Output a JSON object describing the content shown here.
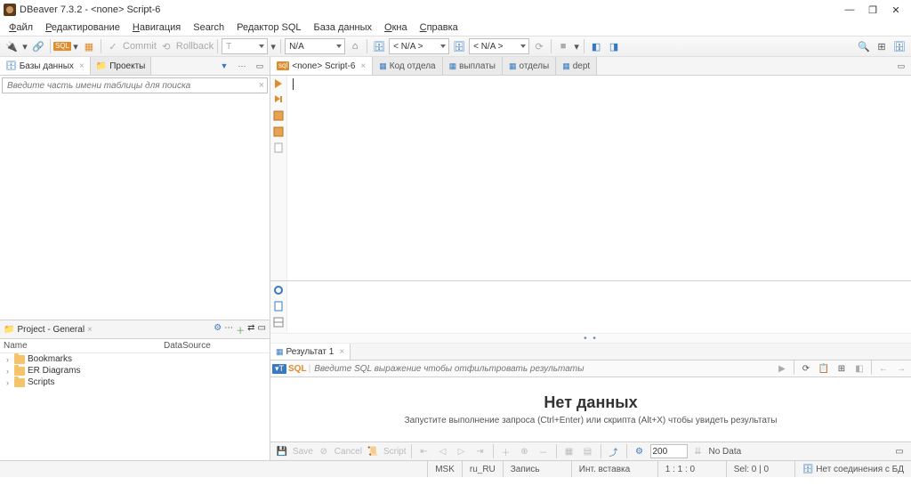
{
  "title": "DBeaver 7.3.2 - <none> Script-6",
  "menu": [
    "Файл",
    "Редактирование",
    "Навигация",
    "Search",
    "Редактор SQL",
    "База данных",
    "Окна",
    "Справка"
  ],
  "menu_underline_idx": [
    0,
    0,
    0,
    null,
    null,
    null,
    0,
    0
  ],
  "toolbar": {
    "commit": "Commit",
    "rollback": "Rollback",
    "combo_t": "T",
    "combo_na": "N/A",
    "combo_na2": "< N/A >",
    "combo_na3": "< N/A >"
  },
  "left_tabs": {
    "databases": "Базы данных",
    "projects": "Проекты"
  },
  "search_placeholder": "Введите часть имени таблицы для поиска",
  "project_panel": {
    "title": "Project - General",
    "col_name": "Name",
    "col_ds": "DataSource",
    "items": [
      "Bookmarks",
      "ER Diagrams",
      "Scripts"
    ]
  },
  "editor_tabs": [
    "<none> Script-6",
    "Код отдела",
    "выплаты",
    "отделы",
    "dept"
  ],
  "result_tab": "Результат 1",
  "sql_label": "SQL",
  "filter_placeholder": "Введите SQL выражение чтобы отфильтровать результаты",
  "nodata": {
    "title": "Нет данных",
    "sub": "Запустите выполнение запроса (Ctrl+Enter) или скрипта (Alt+X) чтобы увидеть результаты"
  },
  "footer": {
    "save": "Save",
    "cancel": "Cancel",
    "script": "Script",
    "fetch": "200",
    "nodata": "No Data"
  },
  "status": {
    "msk": "MSK",
    "locale": "ru_RU",
    "mode": "Запись",
    "ins": "Инт. вставка",
    "pos": "1 : 1 : 0",
    "sel": "Sel: 0 | 0",
    "conn": "Нет соединения с БД"
  }
}
